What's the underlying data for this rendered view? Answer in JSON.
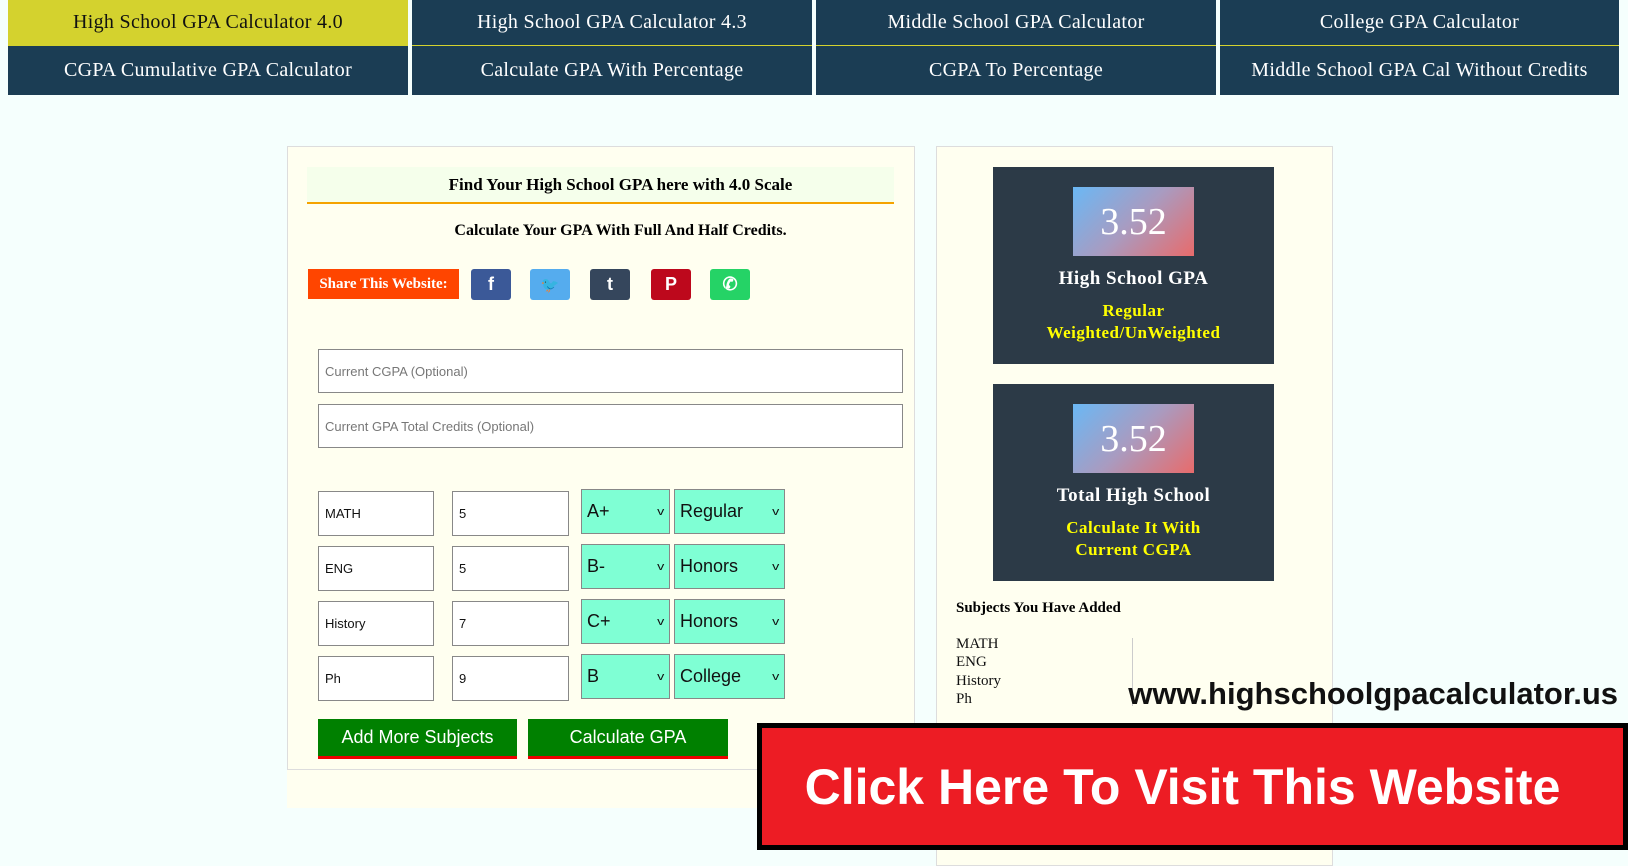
{
  "nav": [
    {
      "label": "High School GPA Calculator 4.0",
      "active": true
    },
    {
      "label": "High School GPA Calculator 4.3"
    },
    {
      "label": "Middle School GPA Calculator"
    },
    {
      "label": "College GPA Calculator"
    },
    {
      "label": "CGPA Cumulative GPA Calculator"
    },
    {
      "label": "Calculate GPA With Percentage"
    },
    {
      "label": "CGPA To Percentage"
    },
    {
      "label": "Middle School GPA Cal Without Credits"
    }
  ],
  "form": {
    "title": "Find Your High School GPA here with 4.0 Scale",
    "subtitle": "Calculate Your GPA With Full And Half Credits.",
    "share_label": "Share This Website:",
    "share_icons": [
      {
        "icon": "facebook-icon",
        "glyph": "f",
        "color": "#3b5998"
      },
      {
        "icon": "twitter-icon",
        "glyph": "🐦",
        "color": "#55acee"
      },
      {
        "icon": "tumblr-icon",
        "glyph": "t",
        "color": "#35465c"
      },
      {
        "icon": "pinterest-icon",
        "glyph": "P",
        "color": "#bd081c"
      },
      {
        "icon": "whatsapp-icon",
        "glyph": "✆",
        "color": "#25d366"
      }
    ],
    "cgpa_placeholder": "Current CGPA (Optional)",
    "credits_placeholder": "Current GPA Total Credits (Optional)",
    "subjects": [
      {
        "name": "MATH",
        "credits": "5",
        "grade": "A+",
        "type": "Regular"
      },
      {
        "name": "ENG",
        "credits": "5",
        "grade": "B-",
        "type": "Honors"
      },
      {
        "name": "History",
        "credits": "7",
        "grade": "C+",
        "type": "Honors"
      },
      {
        "name": "Ph",
        "credits": "9",
        "grade": "B",
        "type": "College"
      }
    ],
    "add_button": "Add More Subjects",
    "calc_button": "Calculate GPA"
  },
  "results": {
    "card1": {
      "value": "3.52",
      "title": "High School GPA",
      "line1": "Regular",
      "line2": "Weighted/UnWeighted"
    },
    "card2": {
      "value": "3.52",
      "title": "Total High School",
      "line1": "Calculate It With",
      "line2": "Current CGPA"
    },
    "subjects_heading": "Subjects You Have Added",
    "subjects_list": [
      "MATH",
      "ENG",
      "History",
      "Ph"
    ]
  },
  "overlay": {
    "url": "www.highschoolgpacalculator.us",
    "banner": "Click Here To Visit This Website"
  },
  "colors": {
    "nav_active": "#d4d22e",
    "nav": "#1b3d54",
    "button": "#008000",
    "banner": "#ed1c24",
    "select": "#7fffd4"
  }
}
